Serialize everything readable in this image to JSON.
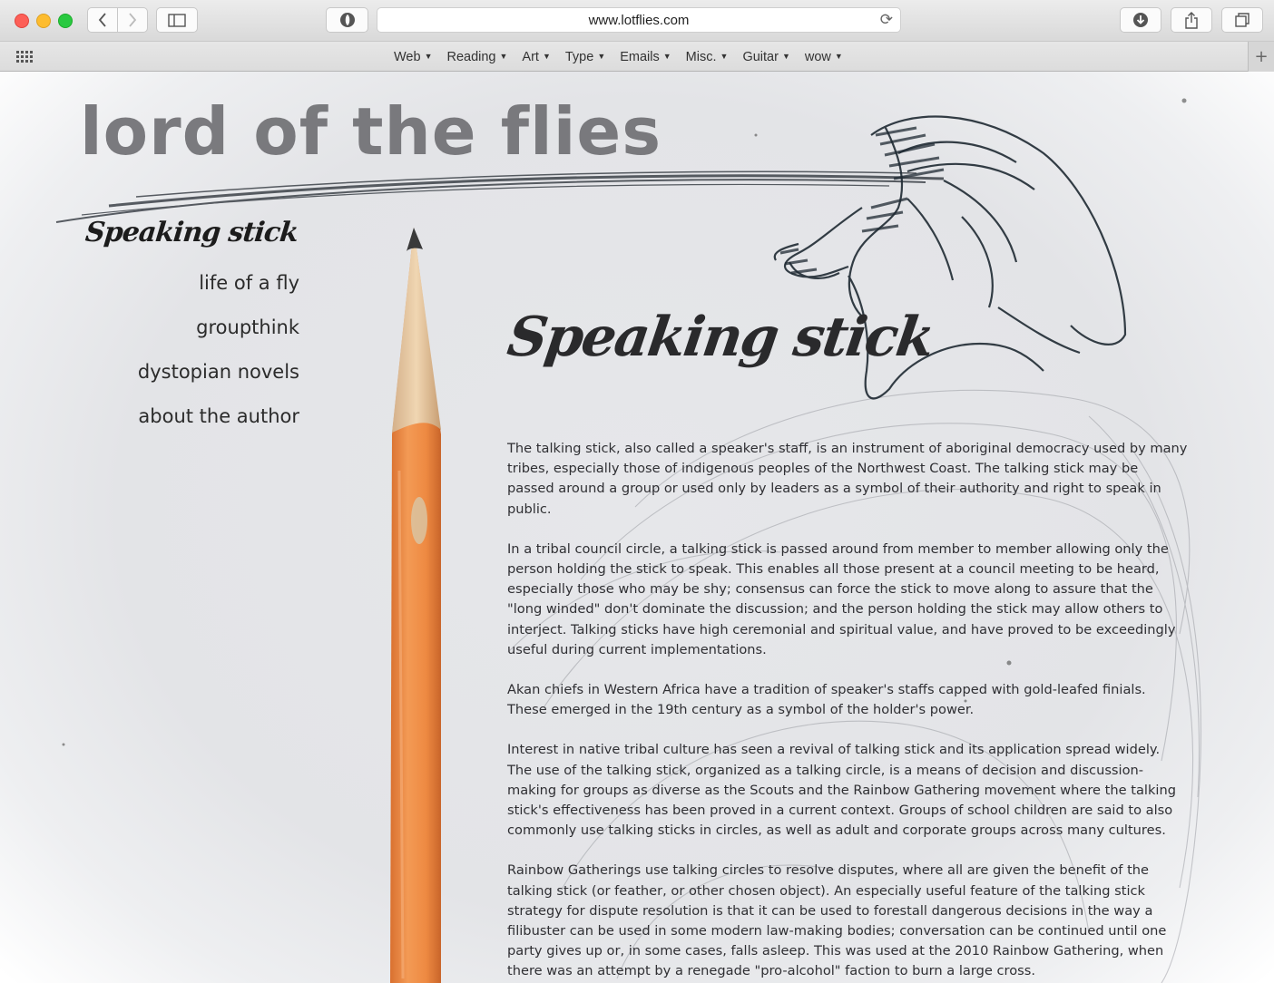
{
  "browser": {
    "url": "www.lotflies.com",
    "favorites": [
      {
        "label": "Web"
      },
      {
        "label": "Reading"
      },
      {
        "label": "Art"
      },
      {
        "label": "Type"
      },
      {
        "label": "Emails"
      },
      {
        "label": "Misc."
      },
      {
        "label": "Guitar"
      },
      {
        "label": "wow"
      }
    ]
  },
  "site": {
    "title": "lord of the flies",
    "nav": {
      "active": "Speaking stick",
      "items": [
        "life of a fly",
        "groupthink",
        "dystopian novels",
        "about the author"
      ]
    }
  },
  "article": {
    "heading": "Speaking stick",
    "paragraphs": [
      "The talking stick, also called a speaker's staff, is an instrument of aboriginal democracy used by many tribes, especially those of indigenous peoples of the Northwest Coast. The talking stick may be passed around a group or used only by leaders as a symbol of their authority and right to speak in public.",
      "In a tribal council circle, a talking stick is passed around from member to member allowing only the person holding the stick to speak. This enables all those present at a council meeting to be heard, especially those who may be shy; consensus can force the stick to move along to assure that the \"long winded\" don't dominate the discussion; and the person holding the stick may allow others to interject. Talking sticks have high ceremonial and spiritual value, and have proved to be exceedingly useful during current implementations.",
      "Akan chiefs in Western Africa have a tradition of speaker's staffs capped with gold-leafed finials. These emerged in the 19th century as a symbol of the holder's power.",
      "Interest in native tribal culture has seen a revival of talking stick and its application spread widely. The use of the talking stick, organized as a talking circle, is a means of decision and discussion-making for groups as diverse as the Scouts and the Rainbow Gathering movement where the talking stick's effectiveness has been proved in a current context. Groups of school children are said to also commonly use talking sticks in circles, as well as adult and corporate groups across many cultures.",
      "Rainbow Gatherings use talking circles to resolve disputes, where all are given the benefit of the talking stick (or feather, or other chosen object). An especially useful feature of the talking stick strategy for dispute resolution is that it can be used to forestall dangerous decisions in the way a filibuster can be used in some modern law-making bodies; conversation can be continued until one party gives up or, in some cases, falls asleep. This was used at the 2010 Rainbow Gathering, when there was an attempt by a renegade \"pro-alcohol\" faction to burn a large cross."
    ]
  },
  "colors": {
    "pencil": "#ef8a45",
    "paper": "#e4e5e8",
    "ink": "#1f2a33"
  }
}
